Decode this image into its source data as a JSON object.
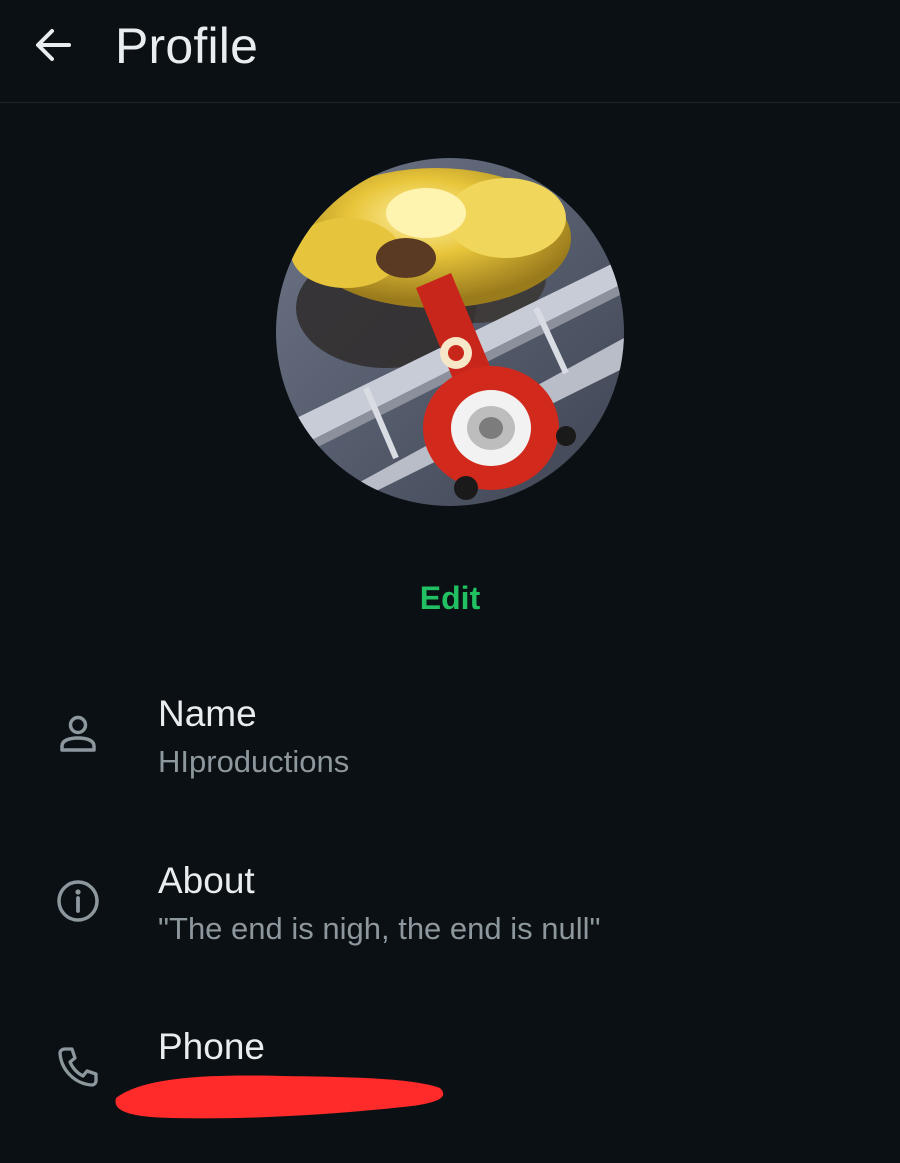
{
  "header": {
    "title": "Profile",
    "back_icon": "arrow-left-icon"
  },
  "profile_photo": {
    "description_icon": "profile-photo-avatar",
    "edit_label": "Edit"
  },
  "colors": {
    "background": "#0b1014",
    "accent": "#21c063",
    "primary_text": "#e9edef",
    "secondary_text": "#8d979e",
    "redaction": "#ff2a2a"
  },
  "fields": {
    "name": {
      "icon": "person-icon",
      "label": "Name",
      "value": "HIproductions"
    },
    "about": {
      "icon": "info-icon",
      "label": "About",
      "value": "\"The end is nigh, the end is null\""
    },
    "phone": {
      "icon": "phone-icon",
      "label": "Phone"
    }
  }
}
